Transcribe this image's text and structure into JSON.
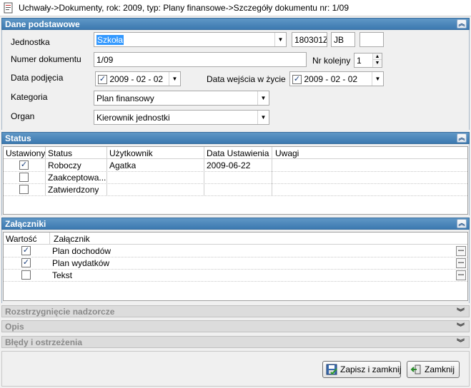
{
  "window": {
    "title": "Uchwały->Dokumenty, rok: 2009, typ: Plany finansowe->Szczegóły dokumentu nr: 1/09"
  },
  "dane": {
    "header": "Dane podstawowe",
    "jednostka_label": "Jednostka",
    "jednostka_value": "Szkoła",
    "code1": "180301Z",
    "code2": "JB",
    "code3": "",
    "numer_label": "Numer dokumentu",
    "numer_value": "1/09",
    "nr_kolejny_label": "Nr kolejny",
    "nr_kolejny_value": "1",
    "data_podjecia_label": "Data podjęcia",
    "data_podjecia_value": "2009 - 02 - 02",
    "data_wejscia_label": "Data wejścia w życie",
    "data_wejscia_value": "2009 - 02 - 02",
    "kategoria_label": "Kategoria",
    "kategoria_value": "Plan finansowy",
    "organ_label": "Organ",
    "organ_value": "Kierownik jednostki"
  },
  "status": {
    "header": "Status",
    "columns": [
      "Ustawiony",
      "Status",
      "Użytkownik",
      "Data Ustawienia",
      "Uwagi"
    ],
    "rows": [
      {
        "checked": true,
        "status": "Roboczy",
        "user": "Agatka",
        "date": "2009-06-22",
        "notes": ""
      },
      {
        "checked": false,
        "status": "Zaakceptowa...",
        "user": "",
        "date": "",
        "notes": ""
      },
      {
        "checked": false,
        "status": "Zatwierdzony",
        "user": "",
        "date": "",
        "notes": ""
      }
    ]
  },
  "zalaczniki": {
    "header": "Załączniki",
    "columns": [
      "Wartość",
      "Załącznik"
    ],
    "rows": [
      {
        "checked": true,
        "name": "Plan dochodów"
      },
      {
        "checked": true,
        "name": "Plan wydatków"
      },
      {
        "checked": false,
        "name": "Tekst"
      }
    ],
    "ellipsis": "..."
  },
  "collapsed": {
    "rozstrzygniecie": "Rozstrzygnięcie nadzorcze",
    "opis": "Opis",
    "bledy": "Błędy i ostrzeżenia"
  },
  "buttons": {
    "save_close": "Zapisz i zamknij",
    "close": "Zamknij"
  },
  "icons": {
    "collapse": "double-chevron-up-icon",
    "expand": "double-chevron-down-icon",
    "combo": "dropdown-arrow-icon"
  },
  "colors": {
    "section_header": "#4a86bb",
    "selection": "#3399ff"
  }
}
